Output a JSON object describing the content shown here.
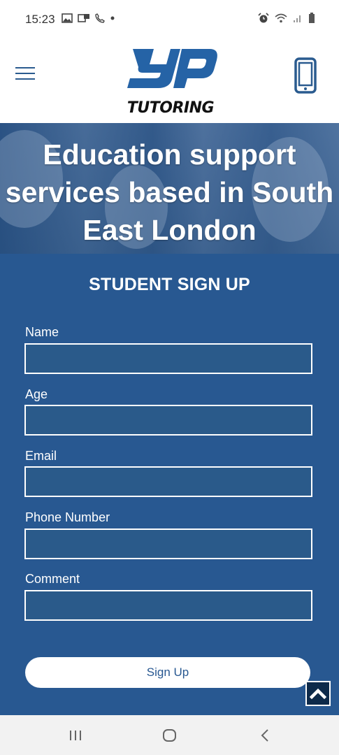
{
  "status_bar": {
    "time": "15:23",
    "left_icons": [
      "image-icon",
      "message-icon",
      "phone-call-icon",
      "dot-icon"
    ],
    "right_icons": [
      "alarm-icon",
      "wifi-icon",
      "signal-icon",
      "battery-icon"
    ]
  },
  "header": {
    "logo_text": "TUTORING",
    "logo_mark": "YP",
    "menu_icon": "hamburger-menu-icon",
    "phone_icon": "mobile-phone-icon",
    "brand_color": "#2a5b8f"
  },
  "hero": {
    "title": "Education support services based in South East London"
  },
  "form": {
    "title": "STUDENT SIGN UP",
    "fields": [
      {
        "label": "Name",
        "value": ""
      },
      {
        "label": "Age",
        "value": ""
      },
      {
        "label": "Email",
        "value": ""
      },
      {
        "label": "Phone Number",
        "value": ""
      },
      {
        "label": "Comment",
        "value": ""
      }
    ],
    "submit_label": "Sign Up",
    "background_color": "#285891"
  },
  "scroll_top": {
    "icon": "chevron-up-icon"
  },
  "nav_bar": {
    "icons": [
      "recent-apps-icon",
      "home-icon",
      "back-icon"
    ]
  }
}
